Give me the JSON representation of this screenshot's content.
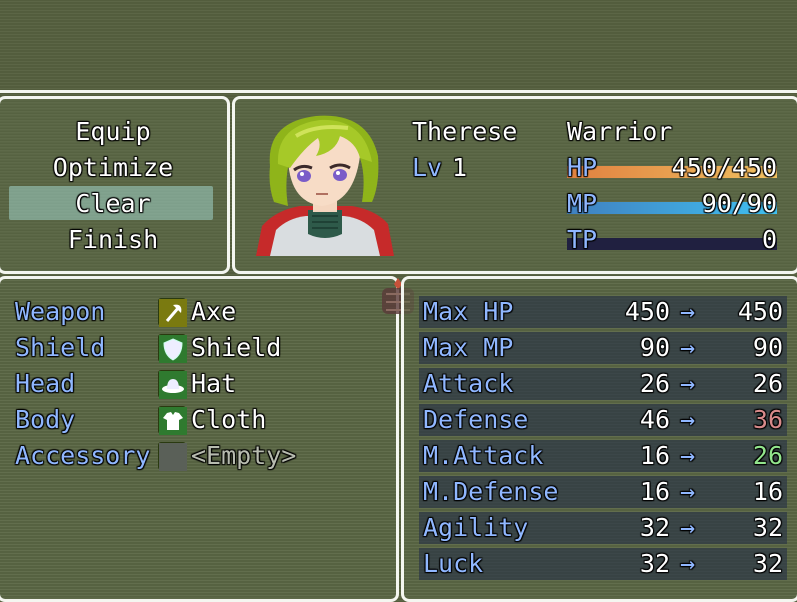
{
  "command_window": {
    "items": [
      "Equip",
      "Optimize",
      "Clear",
      "Finish"
    ],
    "selected": "Clear"
  },
  "actor": {
    "name": "Therese",
    "class": "Warrior",
    "level_label": "Lv",
    "level": "1",
    "hp_label": "HP",
    "hp_text": "450/450",
    "hp_fraction": 1.0,
    "mp_label": "MP",
    "mp_text": "90/90",
    "mp_fraction": 1.0,
    "tp_label": "TP",
    "tp_text": "0",
    "tp_fraction": 0.0
  },
  "equip_slots": [
    {
      "slot": "Weapon",
      "item": "Axe",
      "icon": "axe-icon"
    },
    {
      "slot": "Shield",
      "item": "Shield",
      "icon": "shield-icon"
    },
    {
      "slot": "Head",
      "item": "Hat",
      "icon": "hat-icon"
    },
    {
      "slot": "Body",
      "item": "Cloth",
      "icon": "cloth-icon"
    },
    {
      "slot": "Accessory",
      "item": "<Empty>",
      "icon": "empty-slot-icon"
    }
  ],
  "params": [
    {
      "name": "Max HP",
      "current": "450",
      "arrow": "→",
      "new": "450",
      "change": "same"
    },
    {
      "name": "Max MP",
      "current": "90",
      "arrow": "→",
      "new": "90",
      "change": "same"
    },
    {
      "name": "Attack",
      "current": "26",
      "arrow": "→",
      "new": "26",
      "change": "same"
    },
    {
      "name": "Defense",
      "current": "46",
      "arrow": "→",
      "new": "36",
      "change": "down"
    },
    {
      "name": "M.Attack",
      "current": "16",
      "arrow": "→",
      "new": "26",
      "change": "up"
    },
    {
      "name": "M.Defense",
      "current": "16",
      "arrow": "→",
      "new": "16",
      "change": "same"
    },
    {
      "name": "Agility",
      "current": "32",
      "arrow": "→",
      "new": "32",
      "change": "same"
    },
    {
      "name": "Luck",
      "current": "32",
      "arrow": "→",
      "new": "32",
      "change": "same"
    }
  ],
  "colors": {
    "system_text": "#90b7ff",
    "hp_gauge": [
      "#e08040",
      "#f0c060"
    ],
    "mp_gauge": [
      "#4080c0",
      "#40c0f0"
    ],
    "tp_gauge": [
      "#00a040",
      "#00e060"
    ],
    "param_down": "#d88a8a",
    "param_up": "#92e58c"
  }
}
